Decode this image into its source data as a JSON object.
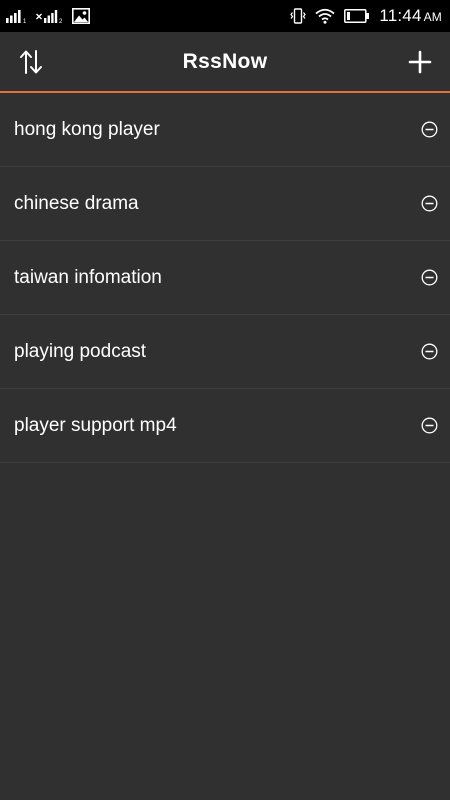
{
  "status_bar": {
    "time": "11:44",
    "ampm": "AM",
    "icons": [
      "signal-icon",
      "no-signal-icon",
      "image-icon",
      "vibrate-icon",
      "wifi-icon",
      "battery-icon"
    ]
  },
  "app_bar": {
    "title": "RssNow",
    "sort_icon": "sort-arrows-icon",
    "add_icon": "plus-icon"
  },
  "colors": {
    "background": "#303030",
    "accent": "#e2733a",
    "text": "#ffffff",
    "divider": "#3d3d3d"
  },
  "feeds": [
    {
      "label": "hong kong player"
    },
    {
      "label": "chinese drama"
    },
    {
      "label": "taiwan infomation"
    },
    {
      "label": "playing podcast"
    },
    {
      "label": "player support mp4"
    }
  ]
}
